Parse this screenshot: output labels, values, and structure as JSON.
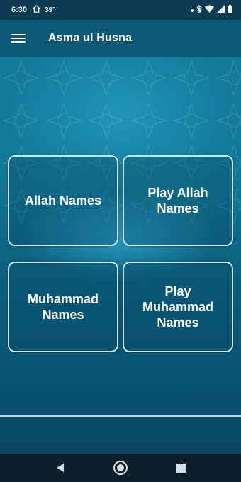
{
  "status_bar": {
    "time": "6:30",
    "icons_left": [
      "home-icon",
      "temperature-icon"
    ],
    "temperature": "39°",
    "icons_right": [
      "notification-dot-icon",
      "bluetooth-icon",
      "wifi-icon",
      "signal-icon",
      "battery-icon"
    ]
  },
  "app_bar": {
    "menu_icon": "hamburger-menu-icon",
    "title": "Asma ul Husna"
  },
  "tiles": [
    {
      "label": "Allah Names"
    },
    {
      "label": "Play Allah Names"
    },
    {
      "label": "Muhammad Names"
    },
    {
      "label": "Play Muhammad Names"
    }
  ],
  "nav_bar": {
    "back": "back-triangle-icon",
    "home": "home-circle-icon",
    "recents": "recents-square-icon"
  },
  "colors": {
    "status_bar": "#0b3c52",
    "app_bar": "#0e5876",
    "background_top": "#137e9e",
    "background_bottom": "#08496a",
    "tile_border": "#c9e6ef",
    "nav_bar": "#0c1f2a"
  }
}
